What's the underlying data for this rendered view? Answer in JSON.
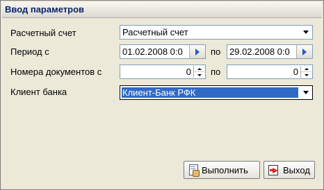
{
  "window": {
    "title": "Ввод параметров"
  },
  "form": {
    "account": {
      "label": "Расчетный счет",
      "value": "Расчетный счет"
    },
    "period": {
      "label": "Период с",
      "from": "01.02.2008 0:0",
      "to_label": "по",
      "to": "29.02.2008 0:0"
    },
    "docs": {
      "label": "Номера документов с",
      "from": "0",
      "to_label": "по",
      "to": "0"
    },
    "bank": {
      "label": "Клиент банка",
      "value": "Клиент-Банк РФК"
    }
  },
  "buttons": {
    "run": "Выполнить",
    "exit": "Выход"
  },
  "colors": {
    "selection": "#316ac5",
    "title_text": "#0a246a",
    "arrow": "#2457c8"
  }
}
